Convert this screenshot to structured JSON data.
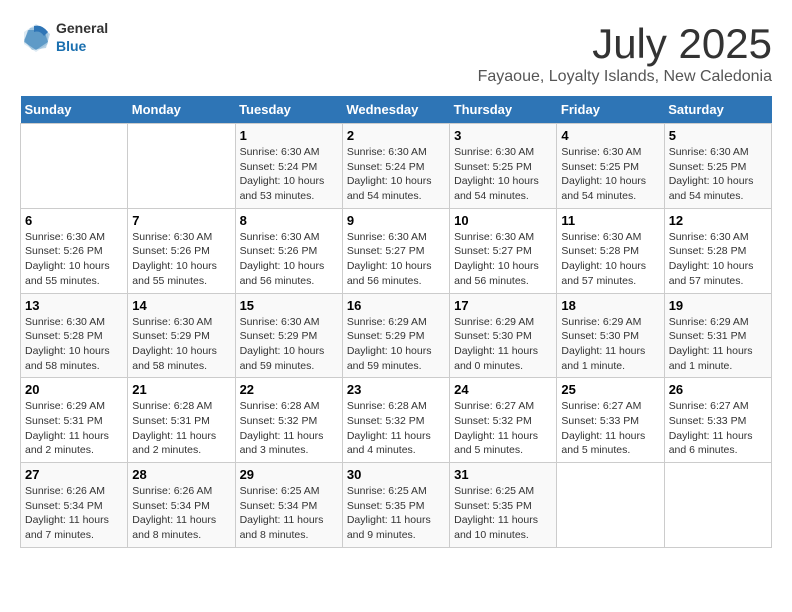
{
  "header": {
    "logo_general": "General",
    "logo_blue": "Blue",
    "month_title": "July 2025",
    "location": "Fayaoue, Loyalty Islands, New Caledonia"
  },
  "weekdays": [
    "Sunday",
    "Monday",
    "Tuesday",
    "Wednesday",
    "Thursday",
    "Friday",
    "Saturday"
  ],
  "weeks": [
    [
      {
        "day": "",
        "info": ""
      },
      {
        "day": "",
        "info": ""
      },
      {
        "day": "1",
        "info": "Sunrise: 6:30 AM\nSunset: 5:24 PM\nDaylight: 10 hours and 53 minutes."
      },
      {
        "day": "2",
        "info": "Sunrise: 6:30 AM\nSunset: 5:24 PM\nDaylight: 10 hours and 54 minutes."
      },
      {
        "day": "3",
        "info": "Sunrise: 6:30 AM\nSunset: 5:25 PM\nDaylight: 10 hours and 54 minutes."
      },
      {
        "day": "4",
        "info": "Sunrise: 6:30 AM\nSunset: 5:25 PM\nDaylight: 10 hours and 54 minutes."
      },
      {
        "day": "5",
        "info": "Sunrise: 6:30 AM\nSunset: 5:25 PM\nDaylight: 10 hours and 54 minutes."
      }
    ],
    [
      {
        "day": "6",
        "info": "Sunrise: 6:30 AM\nSunset: 5:26 PM\nDaylight: 10 hours and 55 minutes."
      },
      {
        "day": "7",
        "info": "Sunrise: 6:30 AM\nSunset: 5:26 PM\nDaylight: 10 hours and 55 minutes."
      },
      {
        "day": "8",
        "info": "Sunrise: 6:30 AM\nSunset: 5:26 PM\nDaylight: 10 hours and 56 minutes."
      },
      {
        "day": "9",
        "info": "Sunrise: 6:30 AM\nSunset: 5:27 PM\nDaylight: 10 hours and 56 minutes."
      },
      {
        "day": "10",
        "info": "Sunrise: 6:30 AM\nSunset: 5:27 PM\nDaylight: 10 hours and 56 minutes."
      },
      {
        "day": "11",
        "info": "Sunrise: 6:30 AM\nSunset: 5:28 PM\nDaylight: 10 hours and 57 minutes."
      },
      {
        "day": "12",
        "info": "Sunrise: 6:30 AM\nSunset: 5:28 PM\nDaylight: 10 hours and 57 minutes."
      }
    ],
    [
      {
        "day": "13",
        "info": "Sunrise: 6:30 AM\nSunset: 5:28 PM\nDaylight: 10 hours and 58 minutes."
      },
      {
        "day": "14",
        "info": "Sunrise: 6:30 AM\nSunset: 5:29 PM\nDaylight: 10 hours and 58 minutes."
      },
      {
        "day": "15",
        "info": "Sunrise: 6:30 AM\nSunset: 5:29 PM\nDaylight: 10 hours and 59 minutes."
      },
      {
        "day": "16",
        "info": "Sunrise: 6:29 AM\nSunset: 5:29 PM\nDaylight: 10 hours and 59 minutes."
      },
      {
        "day": "17",
        "info": "Sunrise: 6:29 AM\nSunset: 5:30 PM\nDaylight: 11 hours and 0 minutes."
      },
      {
        "day": "18",
        "info": "Sunrise: 6:29 AM\nSunset: 5:30 PM\nDaylight: 11 hours and 1 minute."
      },
      {
        "day": "19",
        "info": "Sunrise: 6:29 AM\nSunset: 5:31 PM\nDaylight: 11 hours and 1 minute."
      }
    ],
    [
      {
        "day": "20",
        "info": "Sunrise: 6:29 AM\nSunset: 5:31 PM\nDaylight: 11 hours and 2 minutes."
      },
      {
        "day": "21",
        "info": "Sunrise: 6:28 AM\nSunset: 5:31 PM\nDaylight: 11 hours and 2 minutes."
      },
      {
        "day": "22",
        "info": "Sunrise: 6:28 AM\nSunset: 5:32 PM\nDaylight: 11 hours and 3 minutes."
      },
      {
        "day": "23",
        "info": "Sunrise: 6:28 AM\nSunset: 5:32 PM\nDaylight: 11 hours and 4 minutes."
      },
      {
        "day": "24",
        "info": "Sunrise: 6:27 AM\nSunset: 5:32 PM\nDaylight: 11 hours and 5 minutes."
      },
      {
        "day": "25",
        "info": "Sunrise: 6:27 AM\nSunset: 5:33 PM\nDaylight: 11 hours and 5 minutes."
      },
      {
        "day": "26",
        "info": "Sunrise: 6:27 AM\nSunset: 5:33 PM\nDaylight: 11 hours and 6 minutes."
      }
    ],
    [
      {
        "day": "27",
        "info": "Sunrise: 6:26 AM\nSunset: 5:34 PM\nDaylight: 11 hours and 7 minutes."
      },
      {
        "day": "28",
        "info": "Sunrise: 6:26 AM\nSunset: 5:34 PM\nDaylight: 11 hours and 8 minutes."
      },
      {
        "day": "29",
        "info": "Sunrise: 6:25 AM\nSunset: 5:34 PM\nDaylight: 11 hours and 8 minutes."
      },
      {
        "day": "30",
        "info": "Sunrise: 6:25 AM\nSunset: 5:35 PM\nDaylight: 11 hours and 9 minutes."
      },
      {
        "day": "31",
        "info": "Sunrise: 6:25 AM\nSunset: 5:35 PM\nDaylight: 11 hours and 10 minutes."
      },
      {
        "day": "",
        "info": ""
      },
      {
        "day": "",
        "info": ""
      }
    ]
  ]
}
